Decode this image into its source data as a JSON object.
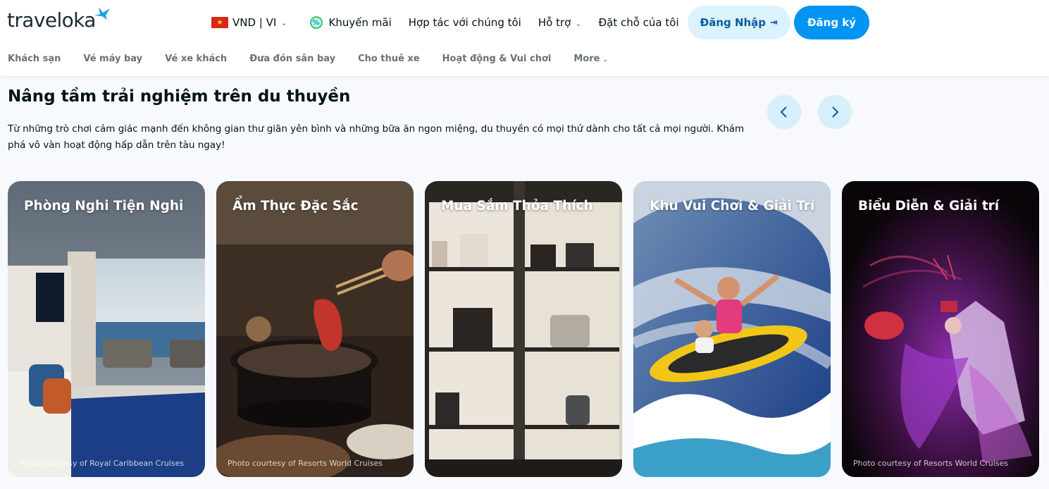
{
  "brand": {
    "name": "traveloka"
  },
  "topnav": {
    "currency": "VND | VI",
    "promo": "Khuyến mãi",
    "partner": "Hợp tác với chúng tôi",
    "support": "Hỗ trợ",
    "bookings": "Đặt chỗ của tôi",
    "login": "Đăng Nhập",
    "register": "Đăng ký"
  },
  "subnav": {
    "items": [
      {
        "label": "Khách sạn"
      },
      {
        "label": "Vé máy bay"
      },
      {
        "label": "Vé xe khách"
      },
      {
        "label": "Đưa đón sân bay"
      },
      {
        "label": "Cho thuê xe"
      },
      {
        "label": "Hoạt động & Vui chơi"
      },
      {
        "label": "More"
      }
    ]
  },
  "section": {
    "title": "Nâng tầm trải nghiệm trên du thuyền",
    "description": "Từ những trò chơi cảm giác mạnh đến không gian thư giãn yên bình và những bữa ăn ngon miệng, du thuyền có mọi thứ dành cho tất cả mọi người. Khám phá vô vàn hoạt động hấp dẫn trên tàu ngay!"
  },
  "cards": [
    {
      "title": "Phòng Nghi Tiện Nghi",
      "credit": "Photo courtesy of Royal Caribbean Cruises"
    },
    {
      "title": "Ẩm Thực Đặc Sắc",
      "credit": "Photo courtesy of Resorts World Cruises"
    },
    {
      "title": "Mua Sắm Thỏa Thích",
      "credit": ""
    },
    {
      "title": "Khu Vui Chơi & Giải Trí",
      "credit": ""
    },
    {
      "title": "Biểu Diễn & Giải trí",
      "credit": "Photo courtesy of Resorts World Cruises"
    }
  ],
  "icons": {
    "logo": "bird-logo-icon",
    "flag": "vietnam-flag-icon",
    "promo": "percent-badge-icon",
    "login": "login-arrow-icon",
    "prev": "chevron-left-icon",
    "next": "chevron-right-icon"
  },
  "colors": {
    "primary": "#0194f3",
    "login_bg": "#dbf3fd",
    "page_bg": "#f7f9fc",
    "text": "#03121a",
    "muted": "#687176"
  }
}
